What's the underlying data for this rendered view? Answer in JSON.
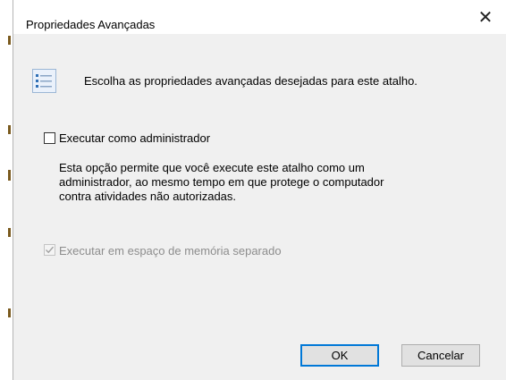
{
  "dialog": {
    "title": "Propriedades Avançadas",
    "close_icon": "close-icon",
    "header_icon": "properties-list-icon",
    "header_text": "Escolha as propriedades avançadas desejadas para este atalho.",
    "run_as_admin": {
      "label": "Executar como administrador",
      "checked": false
    },
    "description_lines": [
      "Esta opção permite que você execute este atalho como um",
      "administrador, ao mesmo tempo em que protege o computador",
      "contra atividades não autorizadas."
    ],
    "separate_memory": {
      "label": "Executar em espaço de memória separado",
      "checked": true,
      "disabled": true
    },
    "ok_label": "OK",
    "cancel_label": "Cancelar"
  },
  "colors": {
    "dialog_bg": "#f0f0f0",
    "title_bg": "#ffffff",
    "focus_border": "#0078d7",
    "disabled_text": "#8d8d8d"
  }
}
